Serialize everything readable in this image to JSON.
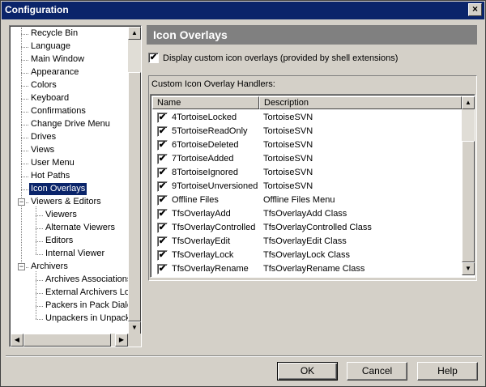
{
  "window": {
    "title": "Configuration",
    "close_glyph": "×"
  },
  "tree": {
    "items": [
      {
        "label": "Recycle Bin",
        "level": 1
      },
      {
        "label": "Language",
        "level": 1
      },
      {
        "label": "Main Window",
        "level": 1
      },
      {
        "label": "Appearance",
        "level": 1
      },
      {
        "label": "Colors",
        "level": 1
      },
      {
        "label": "Keyboard",
        "level": 1
      },
      {
        "label": "Confirmations",
        "level": 1
      },
      {
        "label": "Change Drive Menu",
        "level": 1
      },
      {
        "label": "Drives",
        "level": 1
      },
      {
        "label": "Views",
        "level": 1
      },
      {
        "label": "User Menu",
        "level": 1
      },
      {
        "label": "Hot Paths",
        "level": 1
      },
      {
        "label": "Icon Overlays",
        "level": 1,
        "selected": true
      },
      {
        "label": "Viewers & Editors",
        "level": 0,
        "expander": "−"
      },
      {
        "label": "Viewers",
        "level": 2
      },
      {
        "label": "Alternate Viewers",
        "level": 2
      },
      {
        "label": "Editors",
        "level": 2
      },
      {
        "label": "Internal Viewer",
        "level": 2
      },
      {
        "label": "Archivers",
        "level": 0,
        "expander": "−"
      },
      {
        "label": "Archives Associations",
        "level": 2
      },
      {
        "label": "External Archivers Loc",
        "level": 2
      },
      {
        "label": "Packers in Pack Dialo",
        "level": 2
      },
      {
        "label": "Unpackers in Unpack",
        "level": 2
      }
    ]
  },
  "panel": {
    "title": "Icon Overlays",
    "display_overlays": {
      "checked": true,
      "label": "Display custom icon overlays (provided by shell extensions)"
    },
    "handlers_group": {
      "title": "Custom Icon Overlay Handlers:",
      "columns": {
        "name": "Name",
        "description": "Description"
      },
      "rows": [
        {
          "name": "4TortoiseLocked",
          "description": "TortoiseSVN",
          "checked": true
        },
        {
          "name": "5TortoiseReadOnly",
          "description": "TortoiseSVN",
          "checked": true
        },
        {
          "name": "6TortoiseDeleted",
          "description": "TortoiseSVN",
          "checked": true
        },
        {
          "name": "7TortoiseAdded",
          "description": "TortoiseSVN",
          "checked": true
        },
        {
          "name": "8TortoiseIgnored",
          "description": "TortoiseSVN",
          "checked": true
        },
        {
          "name": "9TortoiseUnversioned",
          "description": "TortoiseSVN",
          "checked": true
        },
        {
          "name": "Offline Files",
          "description": "Offline Files Menu",
          "checked": true
        },
        {
          "name": "TfsOverlayAdd",
          "description": "TfsOverlayAdd Class",
          "checked": true
        },
        {
          "name": "TfsOverlayControlled",
          "description": "TfsOverlayControlled Class",
          "checked": true
        },
        {
          "name": "TfsOverlayEdit",
          "description": "TfsOverlayEdit Class",
          "checked": true
        },
        {
          "name": "TfsOverlayLock",
          "description": "TfsOverlayLock Class",
          "checked": true
        },
        {
          "name": "TfsOverlayRename",
          "description": "TfsOverlayRename Class",
          "checked": true
        }
      ]
    }
  },
  "buttons": {
    "ok": "OK",
    "cancel": "Cancel",
    "help": "Help"
  },
  "glyphs": {
    "check": "✔",
    "up": "▲",
    "down": "▼",
    "left": "◀",
    "right": "▶"
  },
  "colors": {
    "titlebar": "#0a246a",
    "selection": "#0a246a",
    "header": "#808080",
    "face": "#d4d0c8"
  }
}
